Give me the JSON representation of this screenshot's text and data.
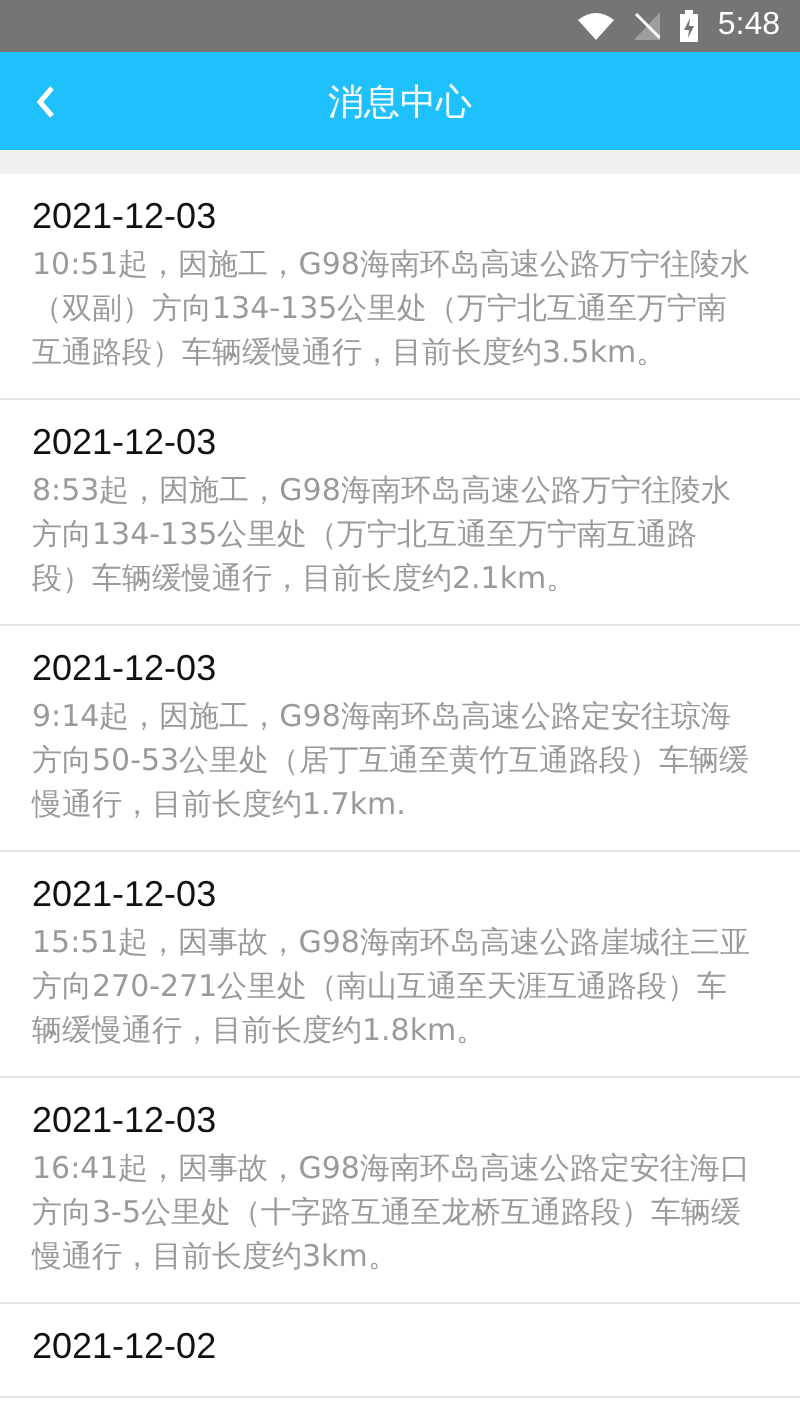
{
  "status_bar": {
    "time": "5:48"
  },
  "header": {
    "title": "消息中心"
  },
  "messages": [
    {
      "date": "2021-12-03",
      "text": "10:51起，因施工，G98海南环岛高速公路万宁往陵水（双副）方向134-135公里处（万宁北互通至万宁南互通路段）车辆缓慢通行，目前长度约3.5km。"
    },
    {
      "date": "2021-12-03",
      "text": "8:53起，因施工，G98海南环岛高速公路万宁往陵水方向134-135公里处（万宁北互通至万宁南互通路段）车辆缓慢通行，目前长度约2.1km。"
    },
    {
      "date": "2021-12-03",
      "text": "9:14起，因施工，G98海南环岛高速公路定安往琼海方向50-53公里处（居丁互通至黄竹互通路段）车辆缓慢通行，目前长度约1.7km."
    },
    {
      "date": "2021-12-03",
      "text": "15:51起，因事故，G98海南环岛高速公路崖城往三亚方向270-271公里处（南山互通至天涯互通路段）车辆缓慢通行，目前长度约1.8km。"
    },
    {
      "date": "2021-12-03",
      "text": "16:41起，因事故，G98海南环岛高速公路定安往海口方向3-5公里处（十字路互通至龙桥互通路段）车辆缓慢通行，目前长度约3km。"
    },
    {
      "date": "2021-12-02"
    }
  ]
}
